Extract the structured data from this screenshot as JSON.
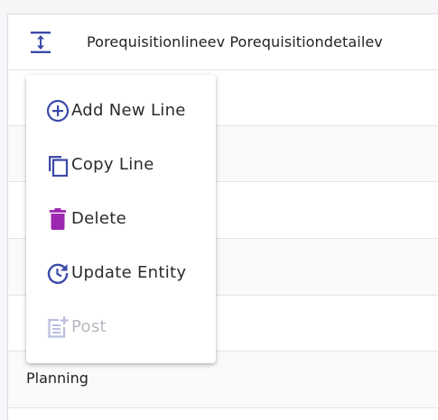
{
  "header": {
    "title": "Porequisitionlineev Porequisitiondetailev",
    "icon": "expand-vertical-icon"
  },
  "rows": {
    "planning_label": "Planning"
  },
  "context_menu": {
    "items": [
      {
        "label": "Add New Line",
        "icon": "plus-circle-icon",
        "color": "#3b4aa8",
        "enabled": true
      },
      {
        "label": "Copy Line",
        "icon": "copy-icon",
        "color": "#3b4aa8",
        "enabled": true
      },
      {
        "label": "Delete",
        "icon": "trash-icon",
        "color": "#9c27b0",
        "enabled": true
      },
      {
        "label": "Update Entity",
        "icon": "update-clock-icon",
        "color": "#3b4aa8",
        "enabled": true
      },
      {
        "label": "Post",
        "icon": "post-add-icon",
        "color": "#b9bfe0",
        "enabled": false
      }
    ]
  },
  "colors": {
    "accent": "#3b4aa8",
    "delete": "#9c27b0",
    "disabled": "#b9bfe0"
  }
}
